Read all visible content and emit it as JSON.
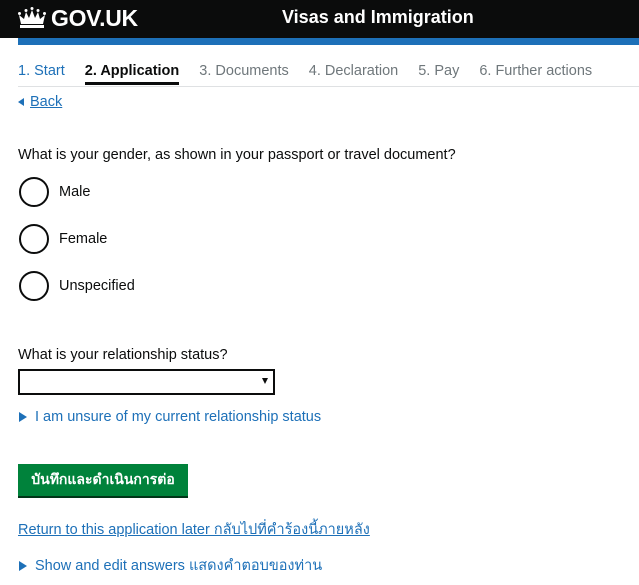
{
  "header": {
    "logo_text": "GOV.UK",
    "service_name": "Visas and Immigration"
  },
  "steps": [
    {
      "label": "1. Start",
      "state": "done"
    },
    {
      "label": "2. Application",
      "state": "active"
    },
    {
      "label": "3. Documents",
      "state": "upcoming"
    },
    {
      "label": "4. Declaration",
      "state": "upcoming"
    },
    {
      "label": "5. Pay",
      "state": "upcoming"
    },
    {
      "label": "6. Further actions",
      "state": "upcoming"
    }
  ],
  "back_link": "Back",
  "gender": {
    "question": "What is your gender, as shown in your passport or travel document?",
    "options": [
      "Male",
      "Female",
      "Unspecified"
    ]
  },
  "relationship": {
    "question": "What is your relationship status?",
    "selected_value": "",
    "unsure_details": "I am unsure of my current relationship status"
  },
  "continue_button": "บันทึกและดำเนินการต่อ",
  "return_link": "Return to this application later กลับไปที่คำร้องนี้ภายหลัง",
  "show_answers": "Show and edit answers แสดงคำตอบของท่าน",
  "colors": {
    "header_bg": "#0b0c0c",
    "accent_blue": "#1d70b8",
    "button_green": "#00823b"
  }
}
